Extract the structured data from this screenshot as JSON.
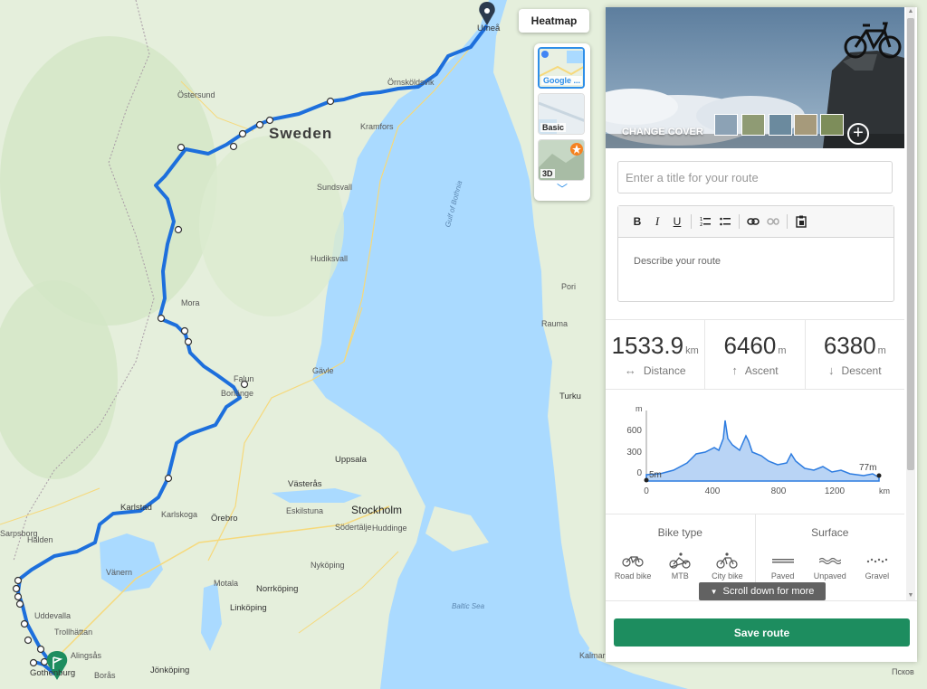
{
  "map": {
    "labels": {
      "country": "Sweden",
      "umea": "Umeå",
      "ostersund": "Östersund",
      "sundsvall": "Sundsvall",
      "hudiksvall": "Hudiksvall",
      "gavle": "Gävle",
      "falun": "Falun",
      "borlange": "Borlänge",
      "uppsala": "Uppsala",
      "vasteras": "Västerås",
      "stockholm": "Stockholm",
      "sodertalje": "Södertälje",
      "huddinge": "Huddinge",
      "orebro": "Örebro",
      "karlstad": "Karlstad",
      "karlskoga": "Karlskoga",
      "norrkoping": "Norrköping",
      "linkoping": "Linköping",
      "jonkoping": "Jönköping",
      "boras": "Borås",
      "gothenburg": "Gothenburg",
      "trollhattan": "Trollhättan",
      "uddevalla": "Uddevalla",
      "vanern": "Vänern",
      "turku": "Turku",
      "pori": "Pori",
      "rauma": "Rauma",
      "gulf": "Gulf of Bothnia",
      "baltic": "Baltic Sea",
      "kramfors": "Kramfors",
      "ornskoldsvik": "Örnsköldsvik",
      "mora": "Mora",
      "eskilstuna": "Eskilstuna",
      "sarpsborg": "Sarpsborg",
      "halden": "Halden",
      "motala": "Motala",
      "alingsas": "Alingsås",
      "nykoping": "Nyköping",
      "kalmar": "Kalmar",
      "pskov": "Псков"
    }
  },
  "controls": {
    "heatmap_label": "Heatmap",
    "layers": [
      {
        "label": "Google ...",
        "active": true
      },
      {
        "label": "Basic",
        "active": false
      },
      {
        "label": "3D",
        "active": false
      }
    ],
    "more_icon": "chevron-down-icon"
  },
  "panel": {
    "change_cover_label": "CHANGE COVER",
    "add_cover_icon": "plus-circle-icon",
    "title_placeholder": "Enter a title for your route",
    "description_placeholder": "Describe your route",
    "toolbar": [
      "B",
      "I",
      "U",
      "ordered-list",
      "bullet-list",
      "link",
      "unlink",
      "paste"
    ],
    "stats": [
      {
        "value": "1533.9",
        "unit": "km",
        "label": "Distance",
        "icon": "↔"
      },
      {
        "value": "6460",
        "unit": "m",
        "label": "Ascent",
        "icon": "↑"
      },
      {
        "value": "6380",
        "unit": "m",
        "label": "Descent",
        "icon": "↓"
      }
    ],
    "elevation": {
      "y_unit": "m",
      "x_unit": "km",
      "y_ticks": [
        "600",
        "300",
        "0"
      ],
      "x_ticks": [
        "0",
        "400",
        "800",
        "1200"
      ],
      "start_label": "5m",
      "end_label": "77m"
    },
    "bike_type": {
      "heading": "Bike type",
      "options": [
        "Road bike",
        "MTB",
        "City bike"
      ]
    },
    "surface": {
      "heading": "Surface",
      "options": [
        "Paved",
        "Unpaved",
        "Gravel"
      ]
    },
    "scroll_hint": "Scroll down for more",
    "save_label": "Save route"
  }
}
